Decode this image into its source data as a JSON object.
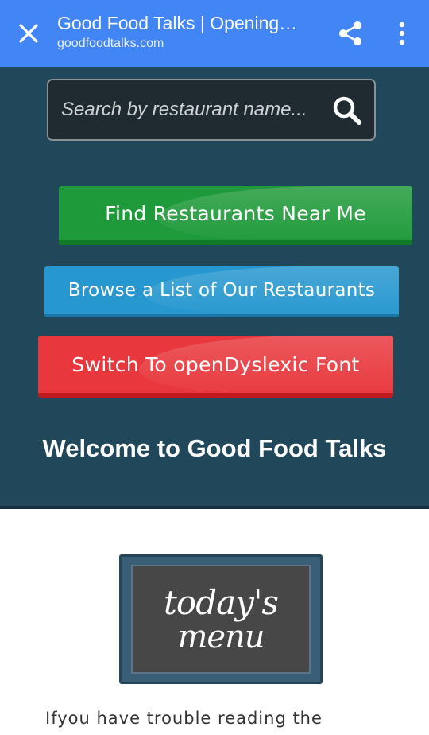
{
  "toolbar": {
    "title": "Good Food Talks | Opening…",
    "url": "goodfoodtalks.com",
    "close_icon": "close-icon",
    "share_icon": "share-icon",
    "menu_icon": "more-vert-icon",
    "background": "#4285f4"
  },
  "header": {
    "search": {
      "placeholder": "Search by restaurant name...",
      "icon": "search-icon"
    },
    "buttons": {
      "find": "Find Restaurants Near Me",
      "browse": "Browse a List of Our Restaurants",
      "dyslexic": "Switch To openDyslexic Font"
    },
    "welcome": "Welcome to Good Food Talks",
    "colors": {
      "background": "#21475a",
      "find": "#1f9a3a",
      "browse": "#2697cf",
      "dyslexic": "#e8383d"
    }
  },
  "content": {
    "sign": {
      "line1": "today's",
      "line2": "menu"
    },
    "text": "Ifyou have trouble reading the"
  }
}
